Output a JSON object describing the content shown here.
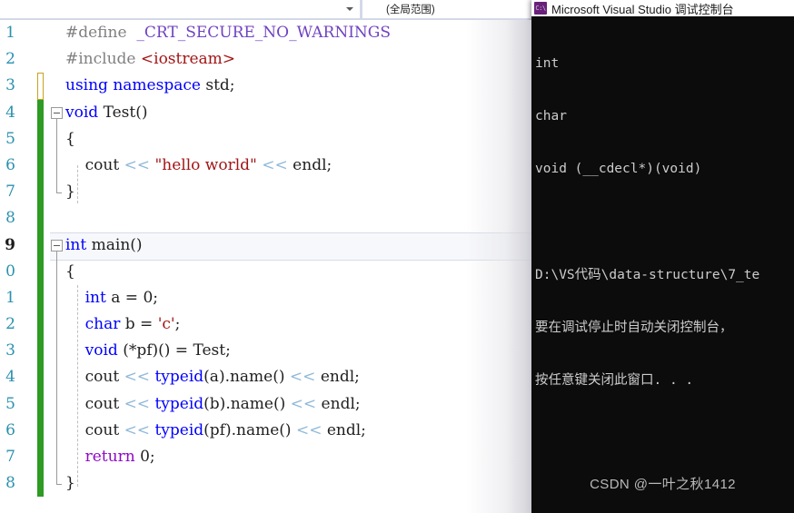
{
  "nav_bar": {
    "member_combo_value": "",
    "member_combo_placeholder": "",
    "scope_combo_value": "(全局范围)",
    "caret_icon": "chevron-down-icon"
  },
  "editor": {
    "current_line": 9,
    "lines": [
      {
        "num": "1",
        "track": "none",
        "text": "#define  _CRT_SECURE_NO_WARNINGS"
      },
      {
        "num": "2",
        "track": "none",
        "text": "#include <iostream>"
      },
      {
        "num": "3",
        "track": "unsaved",
        "text": "using namespace std;"
      },
      {
        "num": "4",
        "track": "saved",
        "text": "void Test()"
      },
      {
        "num": "5",
        "track": "saved",
        "text": "{"
      },
      {
        "num": "6",
        "track": "saved",
        "text": "    cout << \"hello world\" << endl;"
      },
      {
        "num": "7",
        "track": "saved",
        "text": "}"
      },
      {
        "num": "8",
        "track": "saved",
        "text": ""
      },
      {
        "num": "9",
        "track": "saved",
        "text": "int main()"
      },
      {
        "num": "0",
        "track": "saved",
        "text": "{"
      },
      {
        "num": "1",
        "track": "saved",
        "text": "    int a = 0;"
      },
      {
        "num": "2",
        "track": "saved",
        "text": "    char b = 'c';"
      },
      {
        "num": "3",
        "track": "saved",
        "text": "    void (*pf)() = Test;"
      },
      {
        "num": "4",
        "track": "saved",
        "text": "    cout << typeid(a).name() << endl;"
      },
      {
        "num": "5",
        "track": "saved",
        "text": "    cout << typeid(b).name() << endl;"
      },
      {
        "num": "6",
        "track": "saved",
        "text": "    cout << typeid(pf).name() << endl;"
      },
      {
        "num": "7",
        "track": "saved",
        "text": "    return 0;"
      },
      {
        "num": "8",
        "track": "saved",
        "text": "}"
      }
    ],
    "line_numbers": [
      "1",
      "2",
      "3",
      "4",
      "5",
      "6",
      "7",
      "8",
      "9",
      "0",
      "1",
      "2",
      "3",
      "4",
      "5",
      "6",
      "7",
      "8"
    ]
  },
  "console": {
    "icon": "command-prompt-icon",
    "icon_glyph": "C:\\",
    "title": "Microsoft Visual Studio 调试控制台",
    "output": [
      "int",
      "char",
      "void (__cdecl*)(void)",
      "",
      "D:\\VS代码\\data-structure\\7_te",
      "要在调试停止时自动关闭控制台，",
      "按任意键关闭此窗口. . ."
    ],
    "watermark": "CSDN @一叶之秋1412"
  },
  "colors": {
    "keyword": "#0000ff",
    "macro": "#6f42c1",
    "string": "#a31515",
    "preprocessor": "#808080",
    "control": "#8f08c4",
    "stream_operator": "#8fb8d8",
    "line_number": "#2b91af",
    "track_saved": "#2e9b23",
    "track_unsaved": "#c8a21a",
    "console_background": "#0c0c0c",
    "console_foreground": "#cccccc",
    "icon_purple": "#68217a"
  }
}
